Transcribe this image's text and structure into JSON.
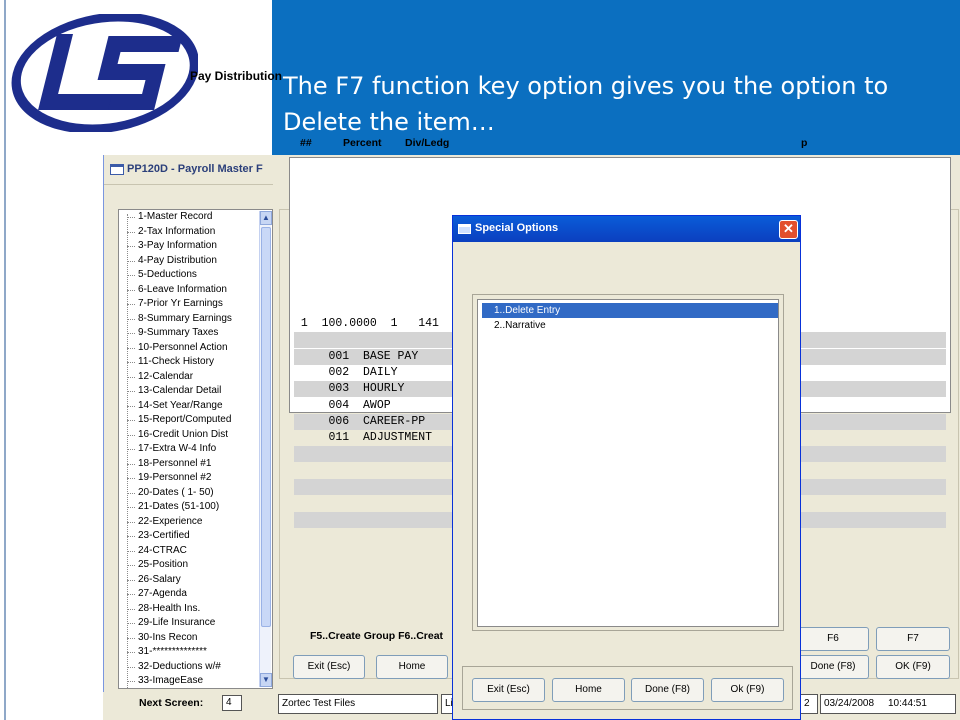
{
  "slide": {
    "caption": "The F7 function key option gives you the option to Delete the item…",
    "colors": {
      "banner": "#0b6fc0",
      "logo": "#1d2d8c",
      "selection": "#316ac5"
    }
  },
  "app": {
    "title": "PP120D - Payroll Master F",
    "nav_items": [
      "1-Master Record",
      "2-Tax Information",
      "3-Pay Information",
      "4-Pay Distribution",
      "5-Deductions",
      "6-Leave Information",
      "7-Prior Yr Earnings",
      "8-Summary Earnings",
      "9-Summary Taxes",
      "10-Personnel Action",
      "11-Check History",
      "12-Calendar",
      "13-Calendar Detail",
      "14-Set Year/Range",
      "15-Report/Computed",
      "16-Credit Union Dist",
      "17-Extra W-4 Info",
      "18-Personnel #1",
      "19-Personnel #2",
      "20-Dates ( 1- 50)",
      "21-Dates (51-100)",
      "22-Experience",
      "23-Certified",
      "24-CTRAC",
      "25-Position",
      "26-Salary",
      "27-Agenda",
      "28-Health Ins.",
      "29-Life Insurance",
      "30-Ins Recon",
      "31-**************",
      "32-Deductions w/#",
      "33-ImageEase"
    ],
    "section_title": "Pay Distribution",
    "grid_headers": {
      "num": "##",
      "percent": "Percent",
      "div": "Div/Ledg",
      "trailing": "p"
    },
    "grid_rows": [
      " 1  100.0000  1   141",
      "",
      "     001  BASE PAY",
      "     002  DAILY",
      "     003  HOURLY",
      "     004  AWOP",
      "     006  CAREER-PP",
      "     011  ADJUSTMENT"
    ],
    "fkey_text": "F5..Create Group  F6..Creat",
    "buttons": {
      "exit": "Exit (Esc)",
      "home": "Home",
      "f6": "F6",
      "f7": "F7",
      "done": "Done (F8)",
      "ok": "OK (F9)"
    },
    "status": {
      "label": "Next Screen:",
      "next_screen": "4",
      "db": "Zortec Test Files",
      "li": "Li",
      "two": "2",
      "date": "03/24/2008",
      "time": "10:44:51"
    }
  },
  "dialog": {
    "title": "Special Options",
    "close_glyph": "✕",
    "options": [
      "1..Delete Entry",
      "2..Narrative"
    ],
    "selected_index": 0,
    "buttons": {
      "exit": "Exit (Esc)",
      "home": "Home",
      "done": "Done (F8)",
      "ok": "Ok (F9)"
    }
  }
}
